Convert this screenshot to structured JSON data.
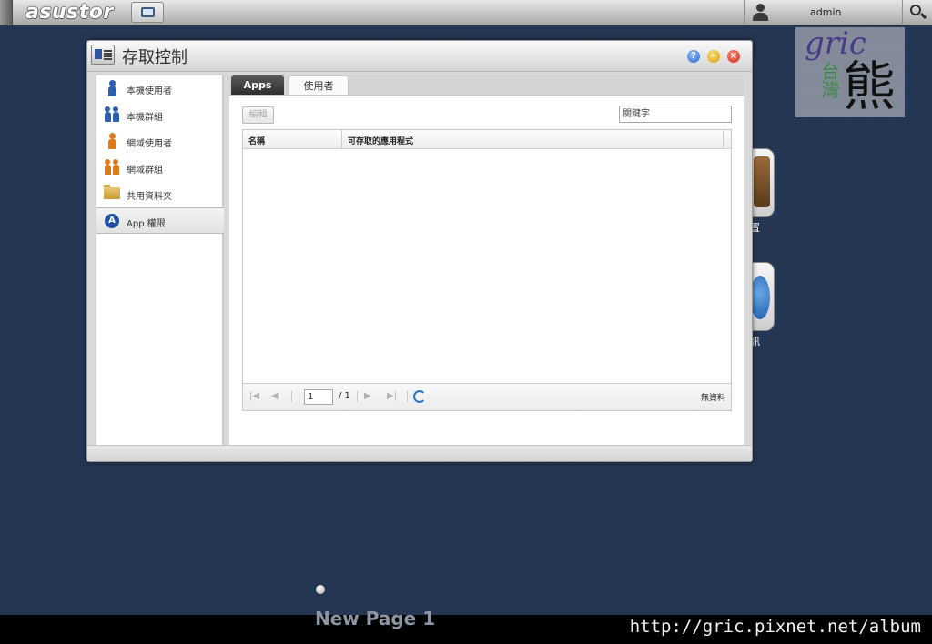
{
  "topbar": {
    "brand": "asustor",
    "user": "admin"
  },
  "watermark": {
    "script": "gric",
    "chars_small": "台灣",
    "char_big": "熊"
  },
  "desktop": {
    "icon_label_1": "置",
    "icon_label_2": "訊",
    "page_name": "New Page 1",
    "footer_url": "http://gric.pixnet.net/album"
  },
  "window": {
    "title": "存取控制",
    "help_glyph": "?",
    "min_glyph": "–",
    "close_glyph": "×"
  },
  "sidebar": {
    "items": [
      {
        "label": "本機使用者"
      },
      {
        "label": "本機群組"
      },
      {
        "label": "網域使用者"
      },
      {
        "label": "網域群組"
      },
      {
        "label": "共用資料夾"
      },
      {
        "label": "App 權限"
      }
    ],
    "active_index": 5
  },
  "tabs": [
    {
      "label": "Apps",
      "active": true
    },
    {
      "label": "使用者",
      "active": false
    }
  ],
  "toolbar": {
    "edit_label": "編輯",
    "keyword_placeholder": "關鍵字"
  },
  "table": {
    "columns": [
      "名稱",
      "可存取的應用程式"
    ],
    "rows": []
  },
  "pager": {
    "page": "1",
    "total": "/ 1",
    "first_glyph": "|◀",
    "prev_glyph": "◀",
    "next_glyph": "▶",
    "last_glyph": "▶|",
    "empty_text": "無資料"
  },
  "colors": {
    "accent": "#2d5fb0",
    "desktop_bg": "#243553"
  },
  "icons": [
    "user-icon",
    "search-icon",
    "desktop-icon",
    "help-icon",
    "minimize-icon",
    "close-icon",
    "user-blue-icon",
    "group-blue-icon",
    "user-orange-icon",
    "group-orange-icon",
    "folder-icon",
    "app-permission-icon",
    "refresh-icon"
  ]
}
